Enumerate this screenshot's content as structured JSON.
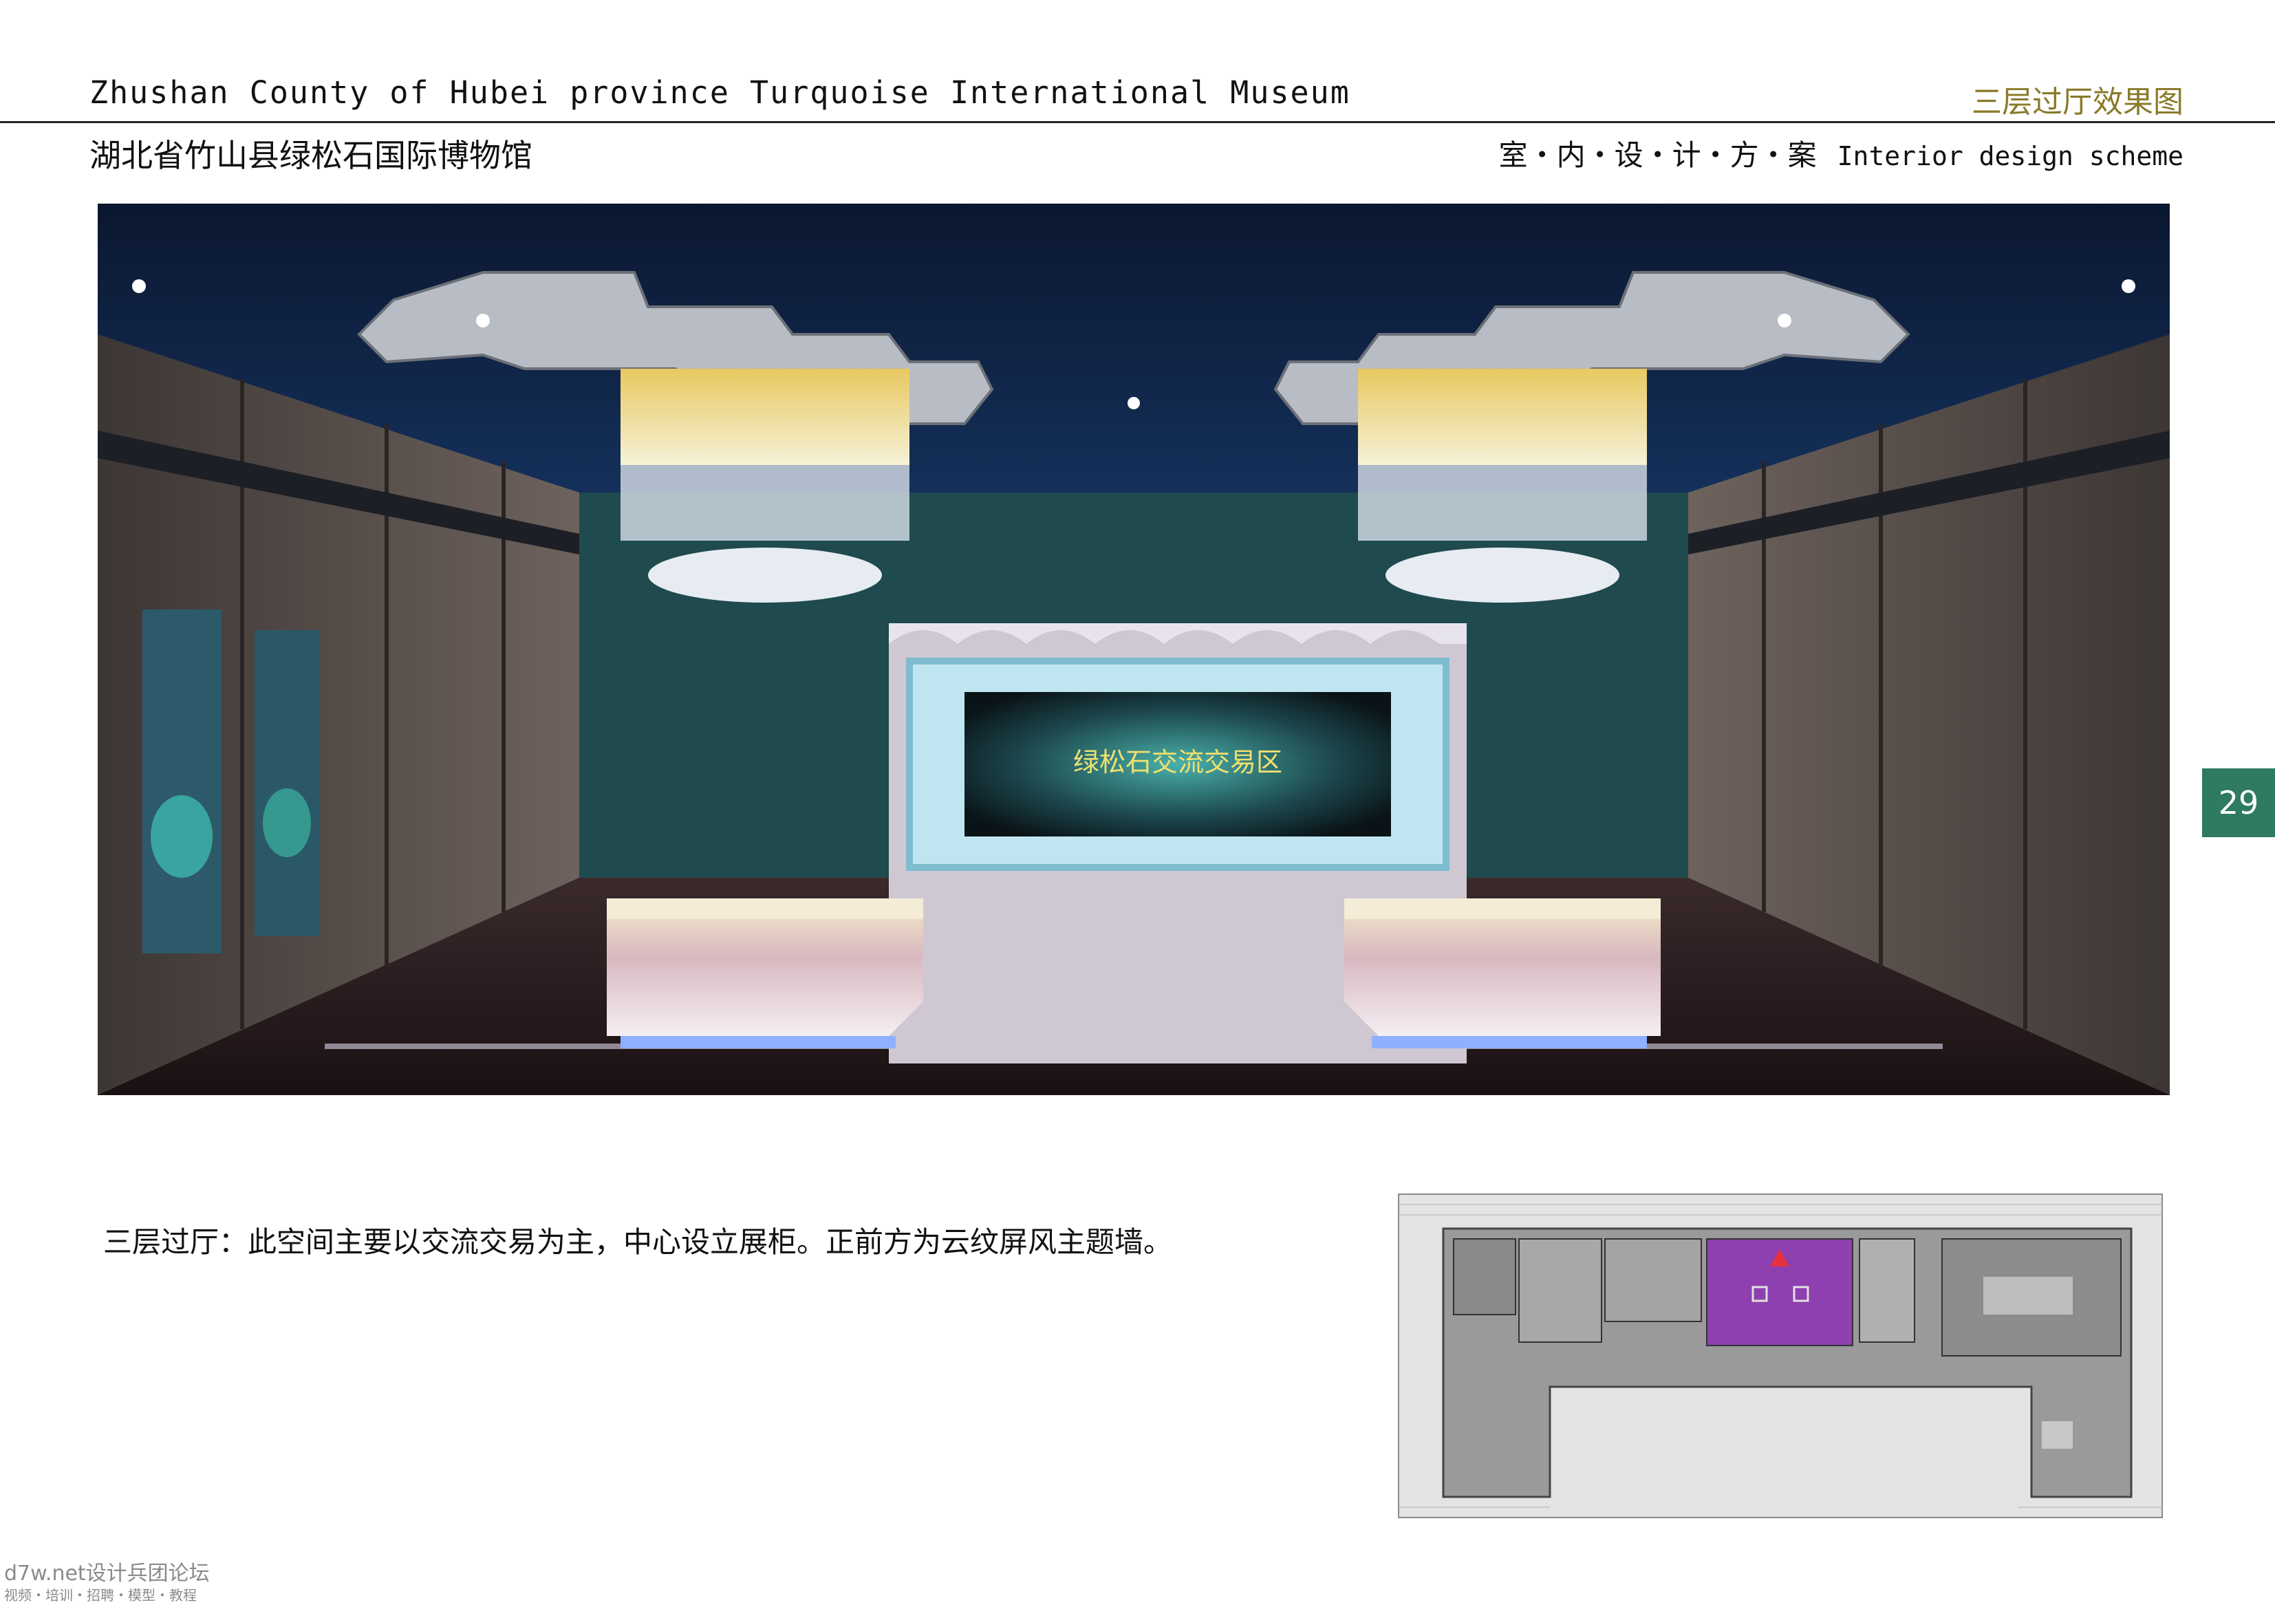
{
  "header": {
    "title_en": "Zhushan County of Hubei province Turquoise International Museum",
    "page_label": "三层过厅效果图",
    "title_cn": "湖北省竹山县绿松石国际博物馆",
    "scheme_cn": "室・内・设・计・方・案",
    "scheme_en": "Interior design scheme"
  },
  "page_number": "29",
  "render": {
    "screen_text": "绿松石交流交易区"
  },
  "caption": "三层过厅：此空间主要以交流交易为主，中心设立展柜。正前方为云纹屏风主题墙。",
  "watermark": {
    "line1": "d7w.net设计兵团论坛",
    "line2": "视频・培训・招聘・模型・教程"
  },
  "colors": {
    "accent_gold": "#8a7a2a",
    "badge_green": "#2e7a63",
    "plan_highlight": "#8e3fb0"
  }
}
